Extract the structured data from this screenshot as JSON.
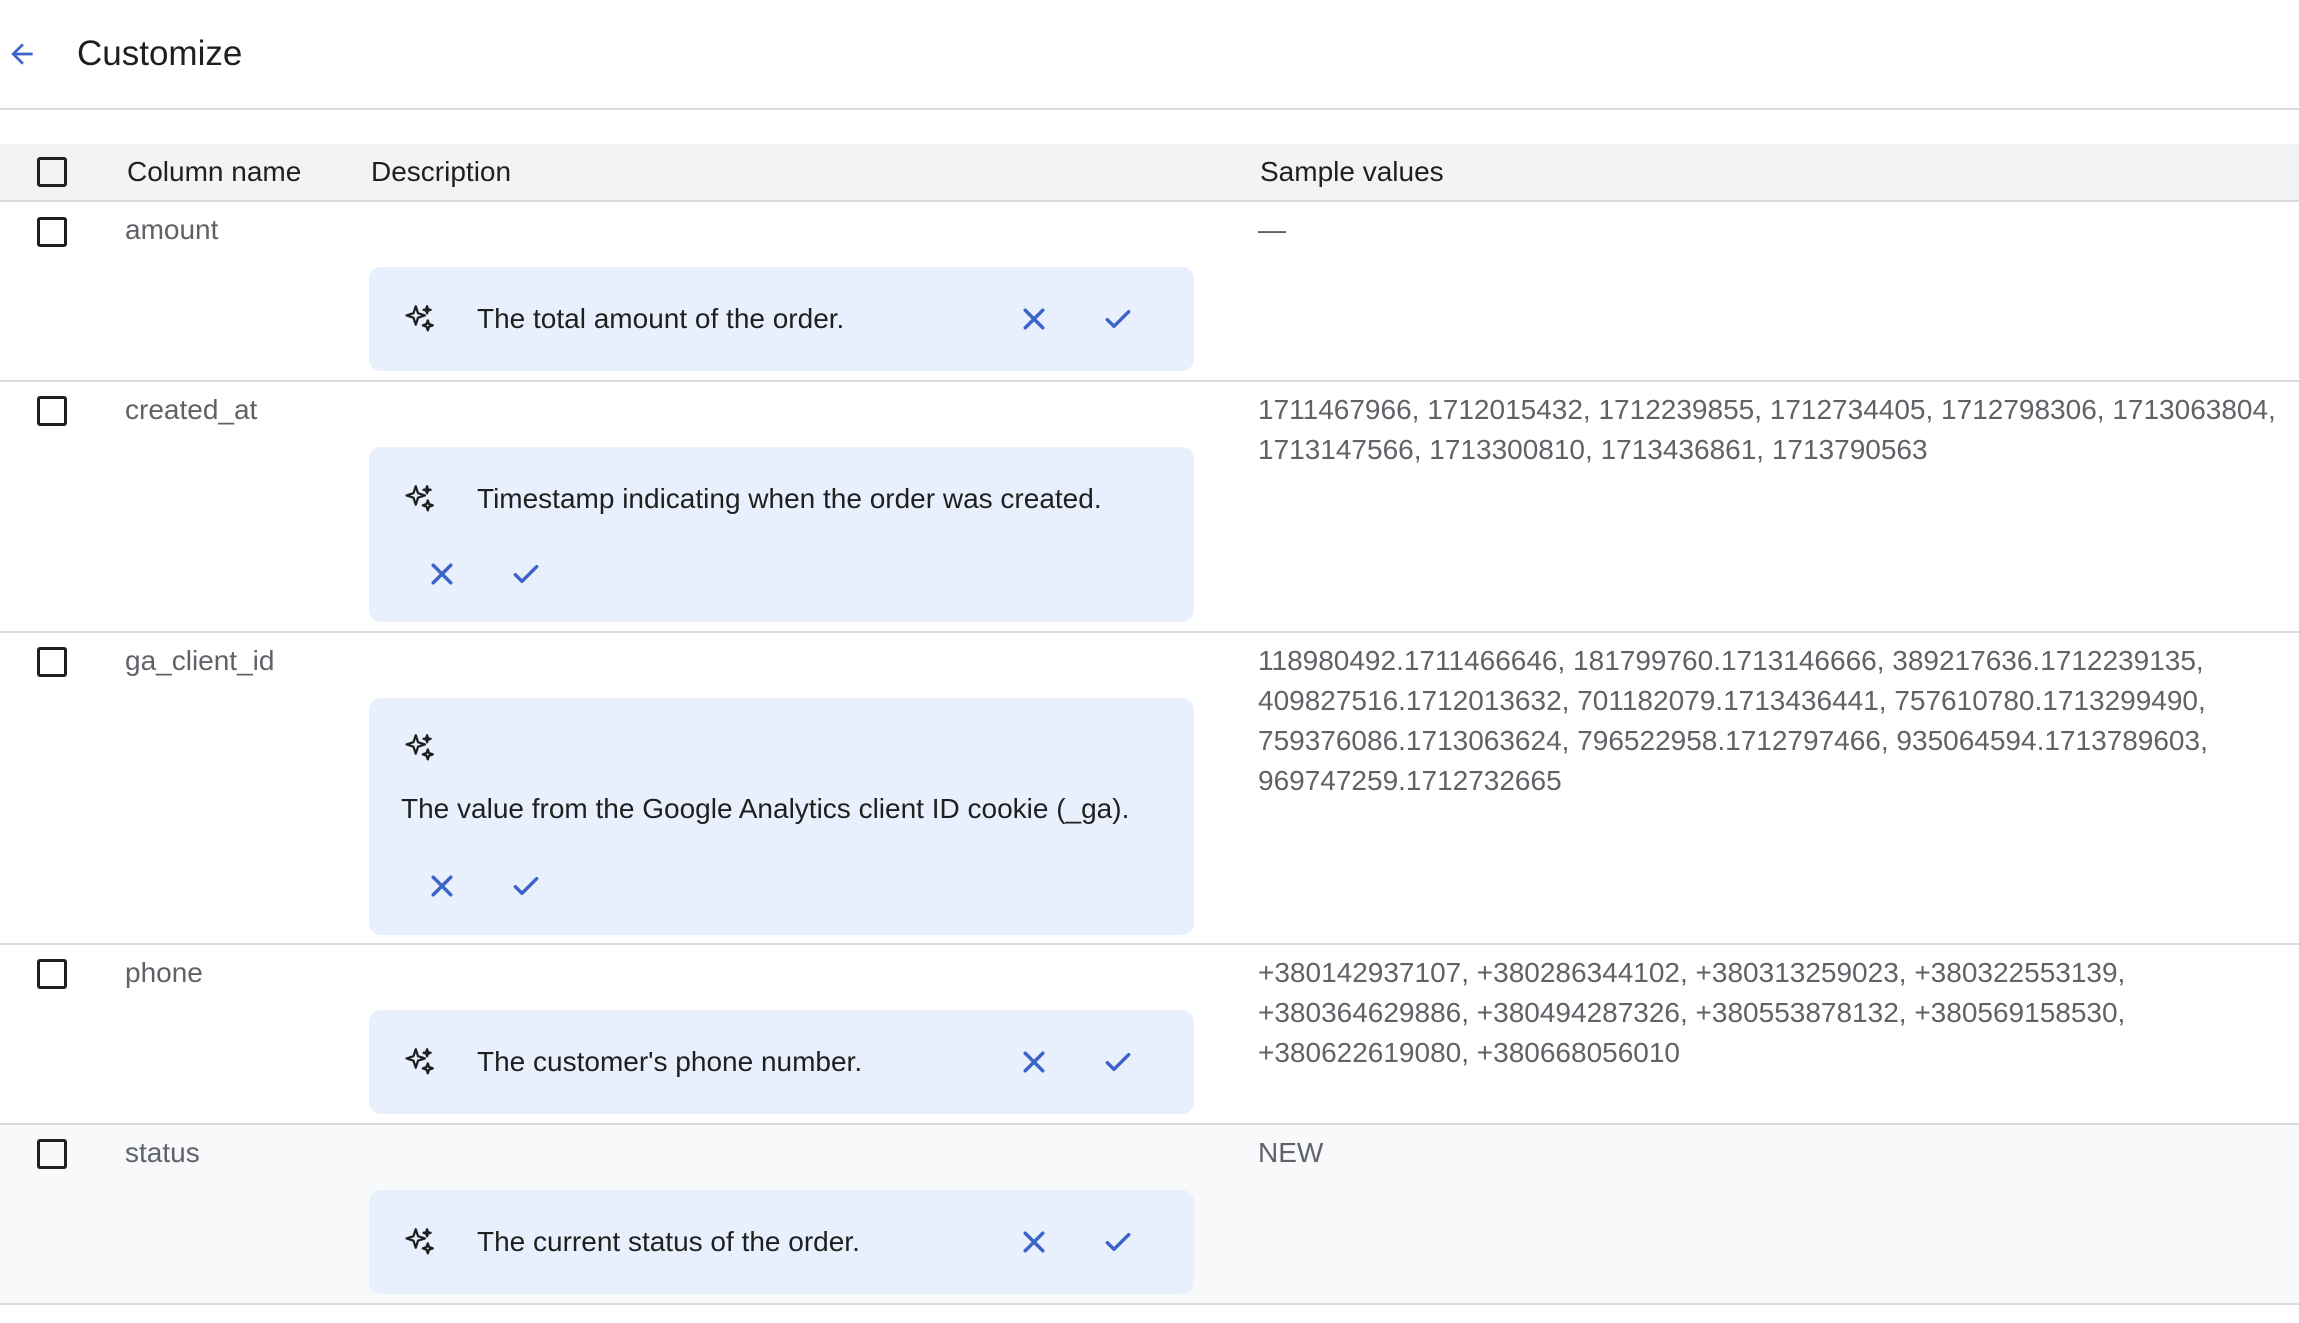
{
  "header": {
    "title": "Customize"
  },
  "table": {
    "headers": {
      "column_name": "Column name",
      "description": "Description",
      "sample_values": "Sample values"
    },
    "rows": [
      {
        "name": "amount",
        "description": "The total amount of the order.",
        "sample": "—"
      },
      {
        "name": "created_at",
        "description": "Timestamp indicating when the order was created.",
        "sample": "1711467966, 1712015432, 1712239855, 1712734405, 1712798306, 1713063804, 1713147566, 1713300810, 1713436861, 1713790563"
      },
      {
        "name": "ga_client_id",
        "description": "The value from the Google Analytics client ID cookie (_ga).",
        "sample": "118980492.1711466646, 181799760.1713146666, 389217636.1712239135, 409827516.1712013632, 701182079.1713436441, 757610780.1713299490, 759376086.1713063624, 796522958.1712797466, 935064594.1713789603, 969747259.1712732665"
      },
      {
        "name": "phone",
        "description": "The customer's phone number.",
        "sample": "+380142937107, +380286344102, +380313259023, +380322553139, +380364629886, +380494287326, +380553878132, +380569158530, +380622619080, +380668056010"
      },
      {
        "name": "status",
        "description": "The current status of the order.",
        "sample": "NEW"
      }
    ]
  },
  "colors": {
    "accent": "#3c64c8",
    "suggestion_bg": "#e8f0fe",
    "header_bg": "#f1f3f4",
    "divider": "#dadce0"
  },
  "icons": {
    "back": "arrow-back-icon",
    "sparkle": "sparkle-icon",
    "reject": "close-icon",
    "accept": "check-icon"
  }
}
